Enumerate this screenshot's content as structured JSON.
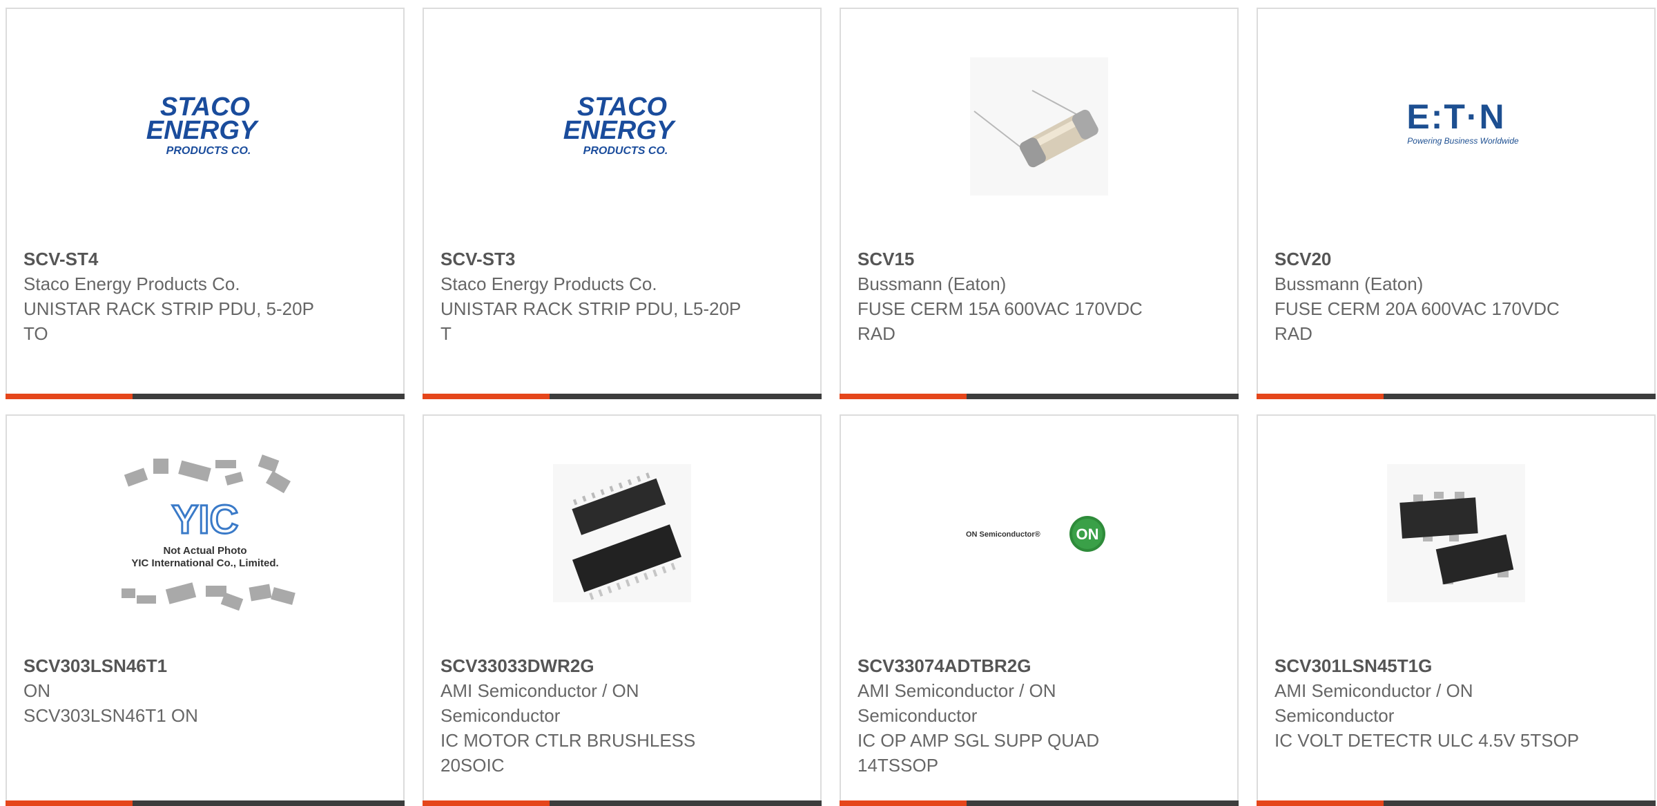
{
  "colors": {
    "accent": "#e5461b",
    "bar": "#3d3d3d",
    "border": "#dcdcdc",
    "text": "#666666",
    "staco_blue": "#1a4c9c",
    "eaton_blue": "#1d4f91",
    "on_green": "#2e8b3a"
  },
  "products": [
    {
      "part_number": "SCV-ST4",
      "manufacturer": "Staco Energy Products Co.",
      "description": "UNISTAR RACK STRIP PDU, 5-20P TO",
      "image": "staco-logo",
      "logo": {
        "line1": "STACO",
        "line2": "ENERGY",
        "line3": "PRODUCTS CO."
      }
    },
    {
      "part_number": "SCV-ST3",
      "manufacturer": "Staco Energy Products Co.",
      "description": "UNISTAR RACK STRIP PDU, L5-20P T",
      "image": "staco-logo",
      "logo": {
        "line1": "STACO",
        "line2": "ENERGY",
        "line3": "PRODUCTS CO."
      }
    },
    {
      "part_number": "SCV15",
      "manufacturer": "Bussmann (Eaton)",
      "description": "FUSE CERM 15A 600VAC 170VDC RAD",
      "image": "fuse-photo"
    },
    {
      "part_number": "SCV20",
      "manufacturer": "Bussmann (Eaton)",
      "description": "FUSE CERM 20A 600VAC 170VDC RAD",
      "image": "eaton-logo",
      "logo": {
        "line1": "E:T·N",
        "line2": "Powering Business Worldwide"
      }
    },
    {
      "part_number": "SCV303LSN46T1",
      "manufacturer": "ON",
      "description": "SCV303LSN46T1 ON",
      "image": "yic-placeholder",
      "logo": {
        "line1": "YIC",
        "line2": "Not Actual Photo",
        "line3": "YIC International Co., Limited."
      }
    },
    {
      "part_number": "SCV33033DWR2G",
      "manufacturer": "AMI Semiconductor / ON Semiconductor",
      "description": "IC MOTOR CTLR BRUSHLESS 20SOIC",
      "image": "soic-chip-photo"
    },
    {
      "part_number": "SCV33074ADTBR2G",
      "manufacturer": "AMI Semiconductor / ON Semiconductor",
      "description": "IC OP AMP SGL SUPP QUAD 14TSSOP",
      "image": "on-semi-logo",
      "logo": {
        "line1": "ON Semiconductor®",
        "line2": "ON"
      }
    },
    {
      "part_number": "SCV301LSN45T1G",
      "manufacturer": "AMI Semiconductor / ON Semiconductor",
      "description": "IC VOLT DETECTR ULC 4.5V 5TSOP",
      "image": "tsop-chip-photo"
    }
  ]
}
